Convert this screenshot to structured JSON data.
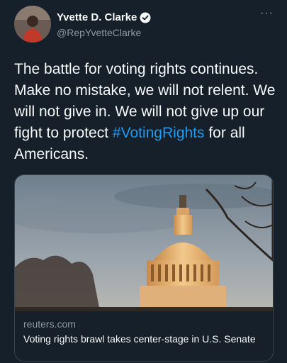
{
  "author": {
    "name": "Yvette D. Clarke",
    "handle": "@RepYvetteClarke"
  },
  "tweet": {
    "text_before": "The battle for voting rights continues. Make no mistake, we will not relent. We will not give in. We will not give up our fight to protect ",
    "hashtag": "#VotingRights",
    "text_after": " for all Americans."
  },
  "link_card": {
    "domain": "reuters.com",
    "title": "Voting rights brawl takes center-stage in U.S. Senate"
  },
  "icons": {
    "verified": "verified-badge-icon",
    "more": "more-options-icon"
  },
  "colors": {
    "background": "#15202b",
    "link": "#1d9bf0",
    "secondary_text": "#8b98a5"
  }
}
